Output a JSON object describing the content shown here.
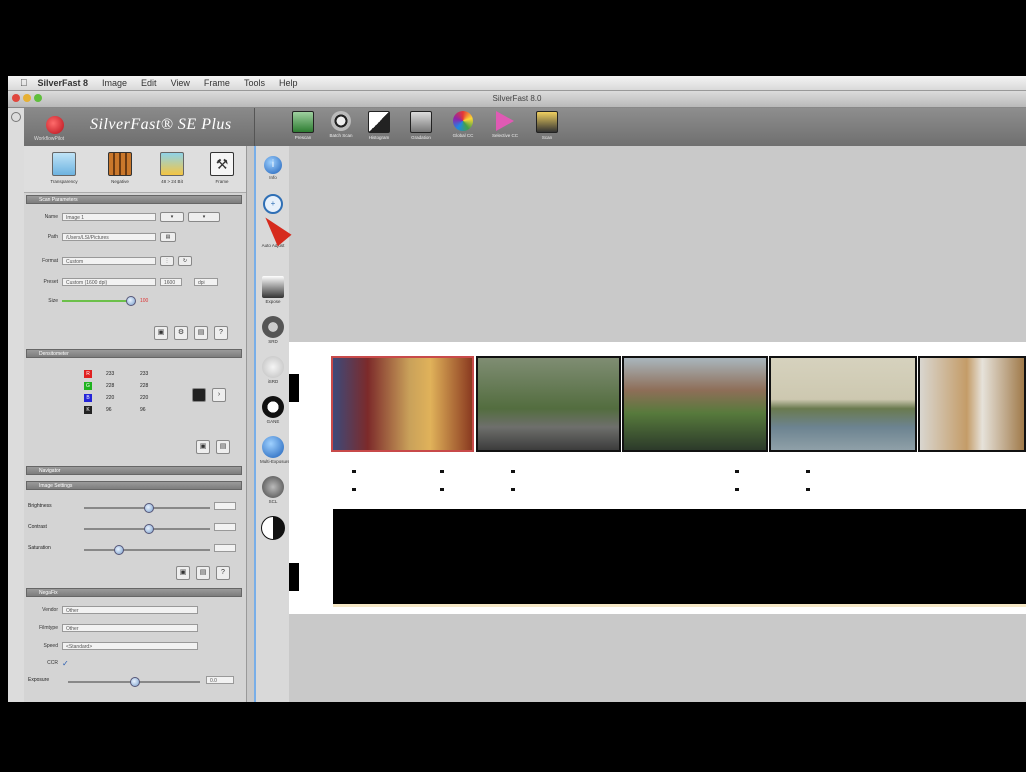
{
  "menubar": {
    "apple": "",
    "items": [
      "SilverFast 8",
      "Image",
      "Edit",
      "View",
      "Frame",
      "Tools",
      "Help"
    ]
  },
  "window": {
    "title": "SilverFast 8.0"
  },
  "brand": {
    "name": "SilverFast® SE Plus",
    "sub": "WorkflowPilot"
  },
  "toolbar": {
    "buttons": [
      "Prescan",
      "Batch Scan",
      "Histogram",
      "Gradation",
      "Global CC",
      "Selective CC",
      "Scan"
    ]
  },
  "scanmodes": [
    "Transparency",
    "Negative",
    "48 > 24 Bit",
    "Frame"
  ],
  "sections": {
    "scan_settings": "Scan Parameters",
    "densitometer": "Densitometer",
    "navigator": "Navigator",
    "image_settings": "Image Settings",
    "negafix": "NegaFix"
  },
  "scan_settings": {
    "name_label": "Name",
    "name_value": "Image 1",
    "path_label": "Path",
    "path_value": "/Users/LSI/Pictures",
    "format_label": "Format",
    "format_value": "Custom",
    "preset_label": "Preset",
    "preset_value": "Custom (1600 dpi)",
    "res_value": "1600",
    "unit_value": "dpi",
    "size_label": "Size",
    "ppi_value": "100"
  },
  "densitometer": {
    "rows": [
      {
        "ch": "R",
        "a": "233",
        "b": "233",
        "color": "#e02020"
      },
      {
        "ch": "G",
        "a": "228",
        "b": "228",
        "color": "#1fb21f"
      },
      {
        "ch": "B",
        "a": "220",
        "b": "220",
        "color": "#2424d8"
      },
      {
        "ch": "K",
        "a": "96",
        "b": "96",
        "color": "#222222"
      }
    ]
  },
  "image_settings": {
    "rows": [
      "Brightness",
      "Contrast",
      "Saturation"
    ]
  },
  "negafix": {
    "vendor_label": "Vendor",
    "vendor_value": "Other",
    "film_label": "Filmtype",
    "film_value": "Other",
    "speed_label": "Speed",
    "speed_value": "<Standard>",
    "ccr_label": "CCR",
    "exposure_label": "Exposure",
    "exposure_value": "0.0"
  },
  "tools": [
    "Info",
    "Zoom",
    "Auto Adjust",
    "Expose",
    "SRD",
    "iSRD",
    "GANE",
    "Multi-Exposure",
    "SCL"
  ],
  "colors": {
    "accent_blue": "#78aee8",
    "cursor_red": "#d62b1e"
  }
}
